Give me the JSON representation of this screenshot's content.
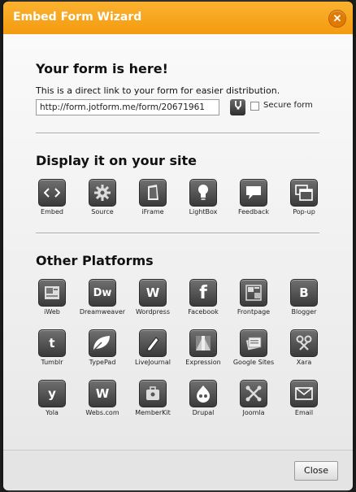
{
  "window": {
    "title": "Embed Form Wizard",
    "close_glyph": "✕"
  },
  "link_section": {
    "heading": "Your form is here!",
    "description": "This is a direct link to your form for easier distribution.",
    "url_value": "http://form.jotform.me/form/20671961",
    "secure_label": "Secure form",
    "secure_checked": false
  },
  "display_section": {
    "heading": "Display it on your site",
    "items": [
      {
        "label": "Embed",
        "icon": "code-icon"
      },
      {
        "label": "Source",
        "icon": "gear-icon"
      },
      {
        "label": "iFrame",
        "icon": "frame-icon"
      },
      {
        "label": "LightBox",
        "icon": "lightbulb-icon"
      },
      {
        "label": "Feedback",
        "icon": "speech-bubble-icon"
      },
      {
        "label": "Pop-up",
        "icon": "popup-window-icon"
      }
    ]
  },
  "platforms_section": {
    "heading": "Other Platforms",
    "items": [
      {
        "label": "iWeb",
        "icon": "iweb-icon"
      },
      {
        "label": "Dreamweaver",
        "icon": "dreamweaver-icon",
        "glyph": "Dw"
      },
      {
        "label": "Wordpress",
        "icon": "wordpress-icon",
        "glyph": "W"
      },
      {
        "label": "Facebook",
        "icon": "facebook-icon",
        "glyph": "f"
      },
      {
        "label": "Frontpage",
        "icon": "frontpage-icon"
      },
      {
        "label": "Blogger",
        "icon": "blogger-icon",
        "glyph": "B"
      },
      {
        "label": "Tumblr",
        "icon": "tumblr-icon",
        "glyph": "t"
      },
      {
        "label": "TypePad",
        "icon": "typepad-icon"
      },
      {
        "label": "LiveJournal",
        "icon": "livejournal-icon"
      },
      {
        "label": "Expression",
        "icon": "expression-icon"
      },
      {
        "label": "Google Sites",
        "icon": "google-sites-icon"
      },
      {
        "label": "Xara",
        "icon": "xara-icon"
      },
      {
        "label": "Yola",
        "icon": "yola-icon",
        "glyph": "y"
      },
      {
        "label": "Webs.com",
        "icon": "webs-icon",
        "glyph": "W"
      },
      {
        "label": "MemberKit",
        "icon": "memberkit-icon"
      },
      {
        "label": "Drupal",
        "icon": "drupal-icon"
      },
      {
        "label": "Joomla",
        "icon": "joomla-icon"
      },
      {
        "label": "Email",
        "icon": "envelope-icon"
      }
    ]
  },
  "footer": {
    "close_label": "Close"
  }
}
